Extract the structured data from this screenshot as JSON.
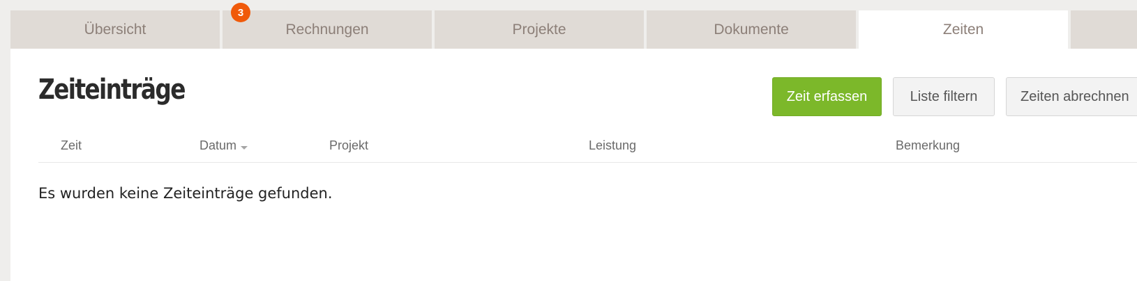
{
  "tabs": [
    {
      "label": "Übersicht",
      "active": false
    },
    {
      "label": "Rechnungen",
      "active": false,
      "badge": "3"
    },
    {
      "label": "Projekte",
      "active": false
    },
    {
      "label": "Dokumente",
      "active": false
    },
    {
      "label": "Zeiten",
      "active": true
    },
    {
      "label": "",
      "active": false
    }
  ],
  "page": {
    "title": "Zeiteinträge"
  },
  "actions": {
    "primary_label": "Zeit erfassen",
    "filter_label": "Liste filtern",
    "bill_label": "Zeiten abrechnen"
  },
  "table": {
    "columns": [
      "Zeit",
      "Datum",
      "Projekt",
      "Leistung",
      "Bemerkung"
    ],
    "sorted_column": "Datum",
    "empty_message": "Es wurden keine Zeiteinträge gefunden."
  },
  "colors": {
    "primary": "#7cb82a",
    "badge": "#f05a0a",
    "tab_bg": "#e0dbd6",
    "tab_text": "#8c7f78"
  }
}
